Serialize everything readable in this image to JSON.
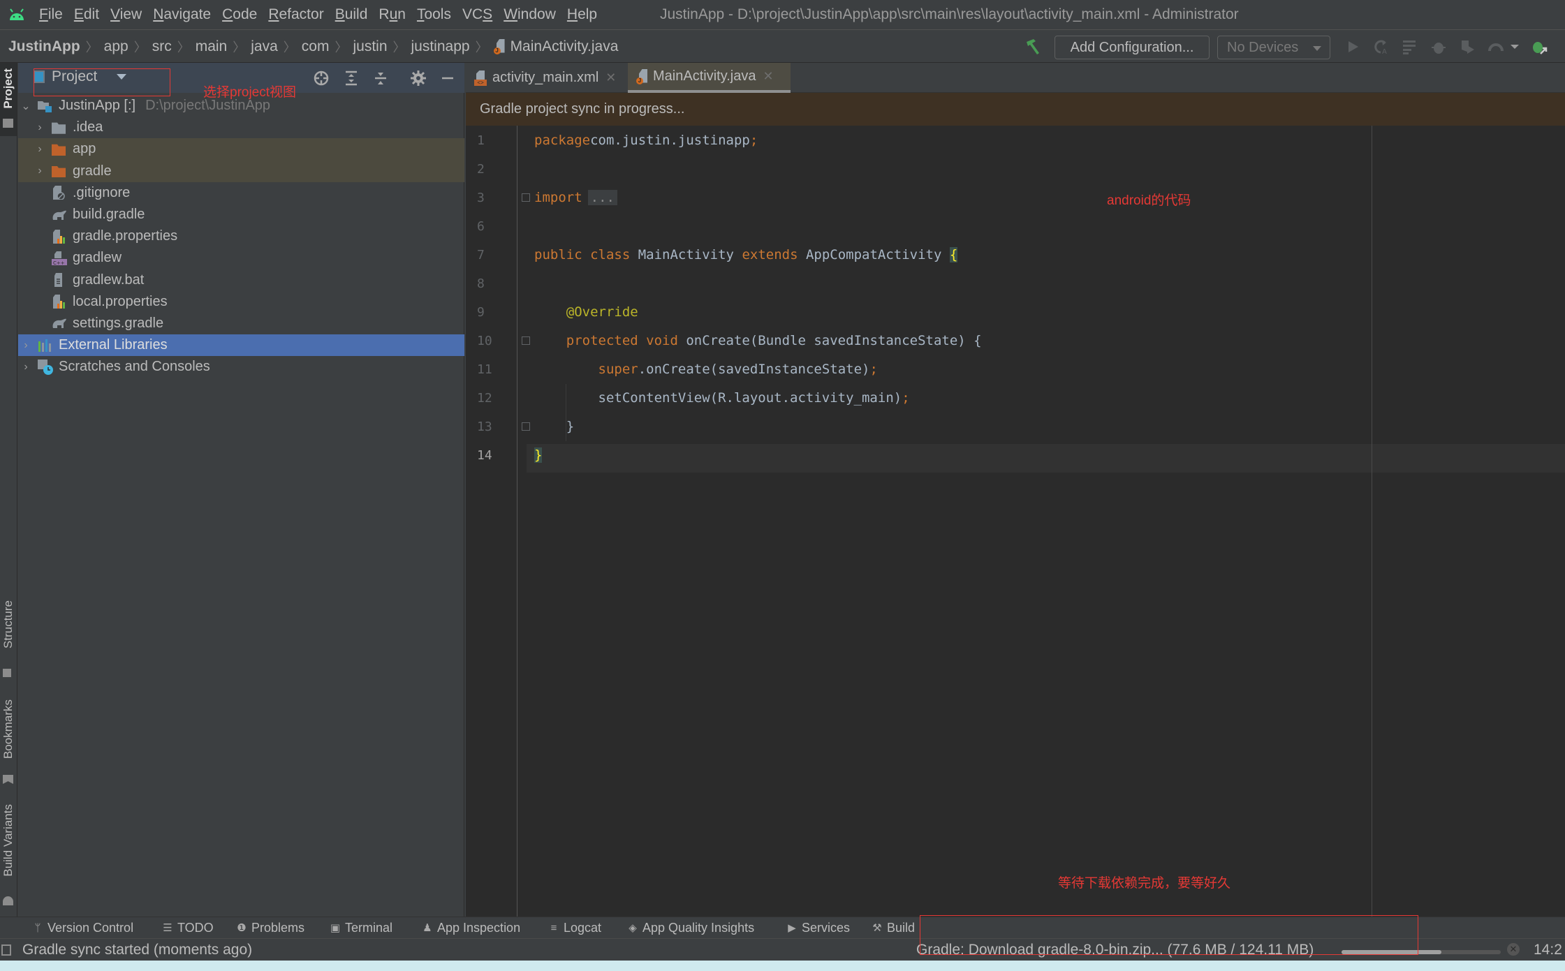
{
  "window": {
    "title": "JustinApp - D:\\project\\JustinApp\\app\\src\\main\\res\\layout\\activity_main.xml - Administrator",
    "app_icon": "android-logo-icon"
  },
  "menu": [
    {
      "label": "File",
      "mnemonic": "F"
    },
    {
      "label": "Edit",
      "mnemonic": "E"
    },
    {
      "label": "View",
      "mnemonic": "V"
    },
    {
      "label": "Navigate",
      "mnemonic": "N"
    },
    {
      "label": "Code",
      "mnemonic": "C"
    },
    {
      "label": "Refactor",
      "mnemonic": "R"
    },
    {
      "label": "Build",
      "mnemonic": "B"
    },
    {
      "label": "Run",
      "mnemonic": "u"
    },
    {
      "label": "Tools",
      "mnemonic": "T"
    },
    {
      "label": "VCS",
      "mnemonic": "S"
    },
    {
      "label": "Window",
      "mnemonic": "W"
    },
    {
      "label": "Help",
      "mnemonic": "H"
    }
  ],
  "breadcrumb": [
    "JustinApp",
    "app",
    "src",
    "main",
    "java",
    "com",
    "justin",
    "justinapp",
    "MainActivity.java"
  ],
  "toolbar": {
    "add_configuration": "Add Configuration...",
    "device_select": "No Devices",
    "icons": [
      "hammer-icon",
      "run-icon",
      "apply-changes-icon",
      "apply-code-changes-icon",
      "debug-icon",
      "coverage-icon",
      "profile-icon",
      "dropdown-icon",
      "attach-debugger-icon"
    ]
  },
  "left_strip": {
    "top": [
      "Project"
    ],
    "bottom": [
      "Structure",
      "Bookmarks",
      "Build Variants"
    ]
  },
  "project_panel": {
    "view_select": "Project",
    "annotation": "选择project视图",
    "tree": [
      {
        "label": "JustinApp [:]",
        "path": "D:\\project\\JustinApp",
        "level": 0,
        "expanded": true,
        "icon": "module-icon",
        "state": ""
      },
      {
        "label": ".idea",
        "level": 1,
        "expanded": false,
        "icon": "folder-icon",
        "state": ""
      },
      {
        "label": "app",
        "level": 1,
        "expanded": false,
        "icon": "folder-orange-icon",
        "state": "modified"
      },
      {
        "label": "gradle",
        "level": 1,
        "expanded": false,
        "icon": "folder-orange-icon",
        "state": "modified"
      },
      {
        "label": ".gitignore",
        "level": 1,
        "icon": "gitignore-file-icon",
        "state": ""
      },
      {
        "label": "build.gradle",
        "level": 1,
        "icon": "gradle-elephant-icon",
        "state": ""
      },
      {
        "label": "gradle.properties",
        "level": 1,
        "icon": "properties-file-icon",
        "state": ""
      },
      {
        "label": "gradlew",
        "level": 1,
        "icon": "script-file-icon",
        "state": ""
      },
      {
        "label": "gradlew.bat",
        "level": 1,
        "icon": "text-file-icon",
        "state": ""
      },
      {
        "label": "local.properties",
        "level": 1,
        "icon": "properties-file-icon",
        "state": ""
      },
      {
        "label": "settings.gradle",
        "level": 1,
        "icon": "gradle-elephant-icon",
        "state": ""
      },
      {
        "label": "External Libraries",
        "level": 0,
        "expanded": false,
        "icon": "libraries-icon",
        "state": "selected"
      },
      {
        "label": "Scratches and Consoles",
        "level": 0,
        "expanded": false,
        "icon": "scratches-icon",
        "state": ""
      }
    ]
  },
  "editor": {
    "tabs": [
      {
        "label": "activity_main.xml",
        "active": false,
        "icon": "xml-file-icon"
      },
      {
        "label": "MainActivity.java",
        "active": true,
        "icon": "java-file-icon"
      }
    ],
    "banner": "Gradle project sync in progress...",
    "annotation_code": "android的代码",
    "annotation_wait": "等待下载依赖完成，要等好久",
    "current_line": 14,
    "lines": [
      {
        "n": "1",
        "tokens": [
          [
            "kw",
            "package"
          ],
          [
            "",
            "com.justin.justinapp"
          ],
          [
            "kw",
            ";"
          ]
        ]
      },
      {
        "n": "2",
        "tokens": []
      },
      {
        "n": "3",
        "tokens": [
          [
            "kw",
            "import"
          ],
          [
            "",
            ""
          ],
          [
            "dots",
            "..."
          ]
        ]
      },
      {
        "n": "6",
        "tokens": []
      },
      {
        "n": "7",
        "tokens": [
          [
            "kw",
            "public class"
          ],
          [
            "",
            " MainActivity "
          ],
          [
            "kw",
            "extends"
          ],
          [
            "",
            " AppCompatActivity "
          ],
          [
            "brace",
            "{"
          ]
        ]
      },
      {
        "n": "8",
        "tokens": []
      },
      {
        "n": "9",
        "tokens": [
          [
            "ann",
            "    @Override"
          ]
        ]
      },
      {
        "n": "10",
        "tokens": [
          [
            "kw",
            "    protected void"
          ],
          [
            "",
            " onCreate(Bundle savedInstanceState) {"
          ]
        ]
      },
      {
        "n": "11",
        "tokens": [
          [
            "kw",
            "        super"
          ],
          [
            "",
            ".onCreate(savedInstanceState)"
          ],
          [
            "kw",
            ";"
          ]
        ]
      },
      {
        "n": "12",
        "tokens": [
          [
            "",
            "        setContentView(R.layout.activity_main)"
          ],
          [
            "kw",
            ";"
          ]
        ]
      },
      {
        "n": "13",
        "tokens": [
          [
            "",
            "    }"
          ]
        ]
      },
      {
        "n": "14",
        "tokens": [
          [
            "brace",
            "}"
          ]
        ]
      }
    ]
  },
  "bottom_tabs": [
    {
      "label": "Version Control",
      "icon": "version-control-icon"
    },
    {
      "label": "TODO",
      "icon": "todo-list-icon"
    },
    {
      "label": "Problems",
      "icon": "problems-icon"
    },
    {
      "label": "Terminal",
      "icon": "terminal-icon"
    },
    {
      "label": "App Inspection",
      "icon": "app-inspection-icon"
    },
    {
      "label": "Logcat",
      "icon": "logcat-icon"
    },
    {
      "label": "App Quality Insights",
      "icon": "app-quality-icon"
    },
    {
      "label": "Services",
      "icon": "services-icon"
    },
    {
      "label": "Build",
      "icon": "build-hammer-icon"
    }
  ],
  "status_bar": {
    "message": "Gradle sync started (moments ago)",
    "task": "Gradle: Download gradle-8.0-bin.zip...  (77.6 MB / 124.11 MB)",
    "progress_percent": 62.5,
    "cursor_position": "14:2"
  },
  "colors": {
    "accent_selection": "#4b6eaf",
    "annotation_red": "#e53935",
    "keyword": "#cc7832",
    "annotation": "#bbb529",
    "android_green": "#3ddc84"
  }
}
